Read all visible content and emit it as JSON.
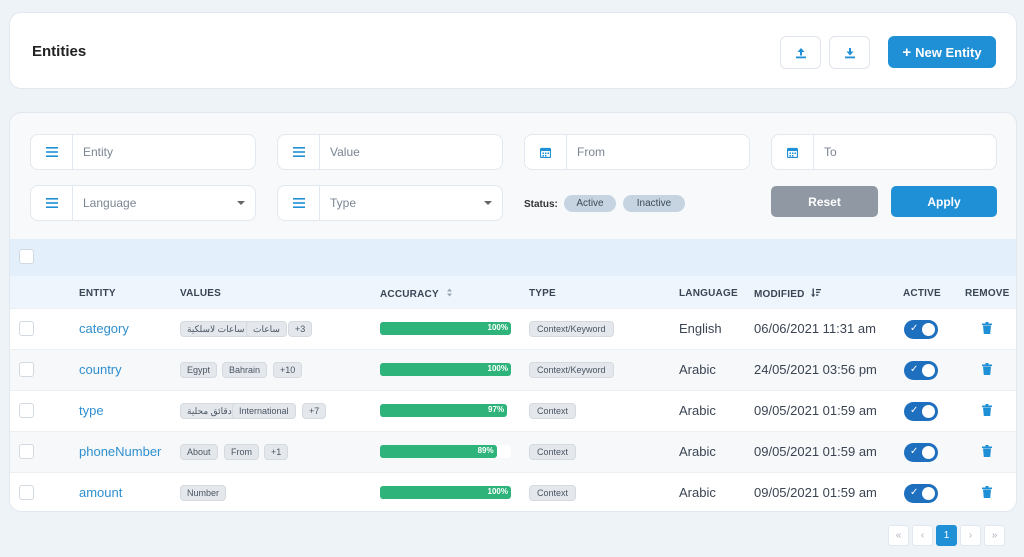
{
  "header": {
    "title": "Entities",
    "upload_icon": "upload-icon",
    "download_icon": "download-icon",
    "new_entity_label": "New Entity",
    "new_entity_plus": "+"
  },
  "filters": {
    "entity_placeholder": "Entity",
    "value_placeholder": "Value",
    "from_placeholder": "From",
    "to_placeholder": "To",
    "language_placeholder": "Language",
    "type_placeholder": "Type",
    "status_label": "Status:",
    "status_options": [
      "Active",
      "Inactive"
    ],
    "reset_label": "Reset",
    "apply_label": "Apply"
  },
  "table": {
    "headers": {
      "entity": "ENTITY",
      "values": "VALUES",
      "accuracy": "ACCURACY",
      "type": "TYPE",
      "language": "LANGUAGE",
      "modified": "MODIFIED",
      "active": "ACTIVE",
      "remove": "REMOVE"
    },
    "rows": [
      {
        "entity": "category",
        "values": [
          "ساعات لاسلكية",
          "ساعات"
        ],
        "more": "+3",
        "accuracy": 100,
        "accuracy_label": "100%",
        "type": "Context/Keyword",
        "language": "English",
        "modified": "06/06/2021 11:31 am",
        "active": true
      },
      {
        "entity": "country",
        "values": [
          "Egypt",
          "Bahrain"
        ],
        "more": "+10",
        "accuracy": 100,
        "accuracy_label": "100%",
        "type": "Context/Keyword",
        "language": "Arabic",
        "modified": "24/05/2021 03:56 pm",
        "active": true
      },
      {
        "entity": "type",
        "values": [
          "دقائق محلية",
          "International"
        ],
        "more": "+7",
        "accuracy": 97,
        "accuracy_label": "97%",
        "type": "Context",
        "language": "Arabic",
        "modified": "09/05/2021 01:59 am",
        "active": true
      },
      {
        "entity": "phoneNumber",
        "values": [
          "About",
          "From"
        ],
        "more": "+1",
        "accuracy": 89,
        "accuracy_label": "89%",
        "type": "Context",
        "language": "Arabic",
        "modified": "09/05/2021 01:59 am",
        "active": true
      },
      {
        "entity": "amount",
        "values": [
          "Number"
        ],
        "more": "",
        "accuracy": 100,
        "accuracy_label": "100%",
        "type": "Context",
        "language": "Arabic",
        "modified": "09/05/2021 01:59 am",
        "active": true
      }
    ]
  },
  "pagination": {
    "first": "«",
    "prev": "‹",
    "current": "1",
    "next": "›",
    "last": "»"
  },
  "colors": {
    "primary": "#1f8fd6",
    "success": "#2eb47a",
    "toggle": "#1f6fbf",
    "link": "#2f8fcf"
  }
}
